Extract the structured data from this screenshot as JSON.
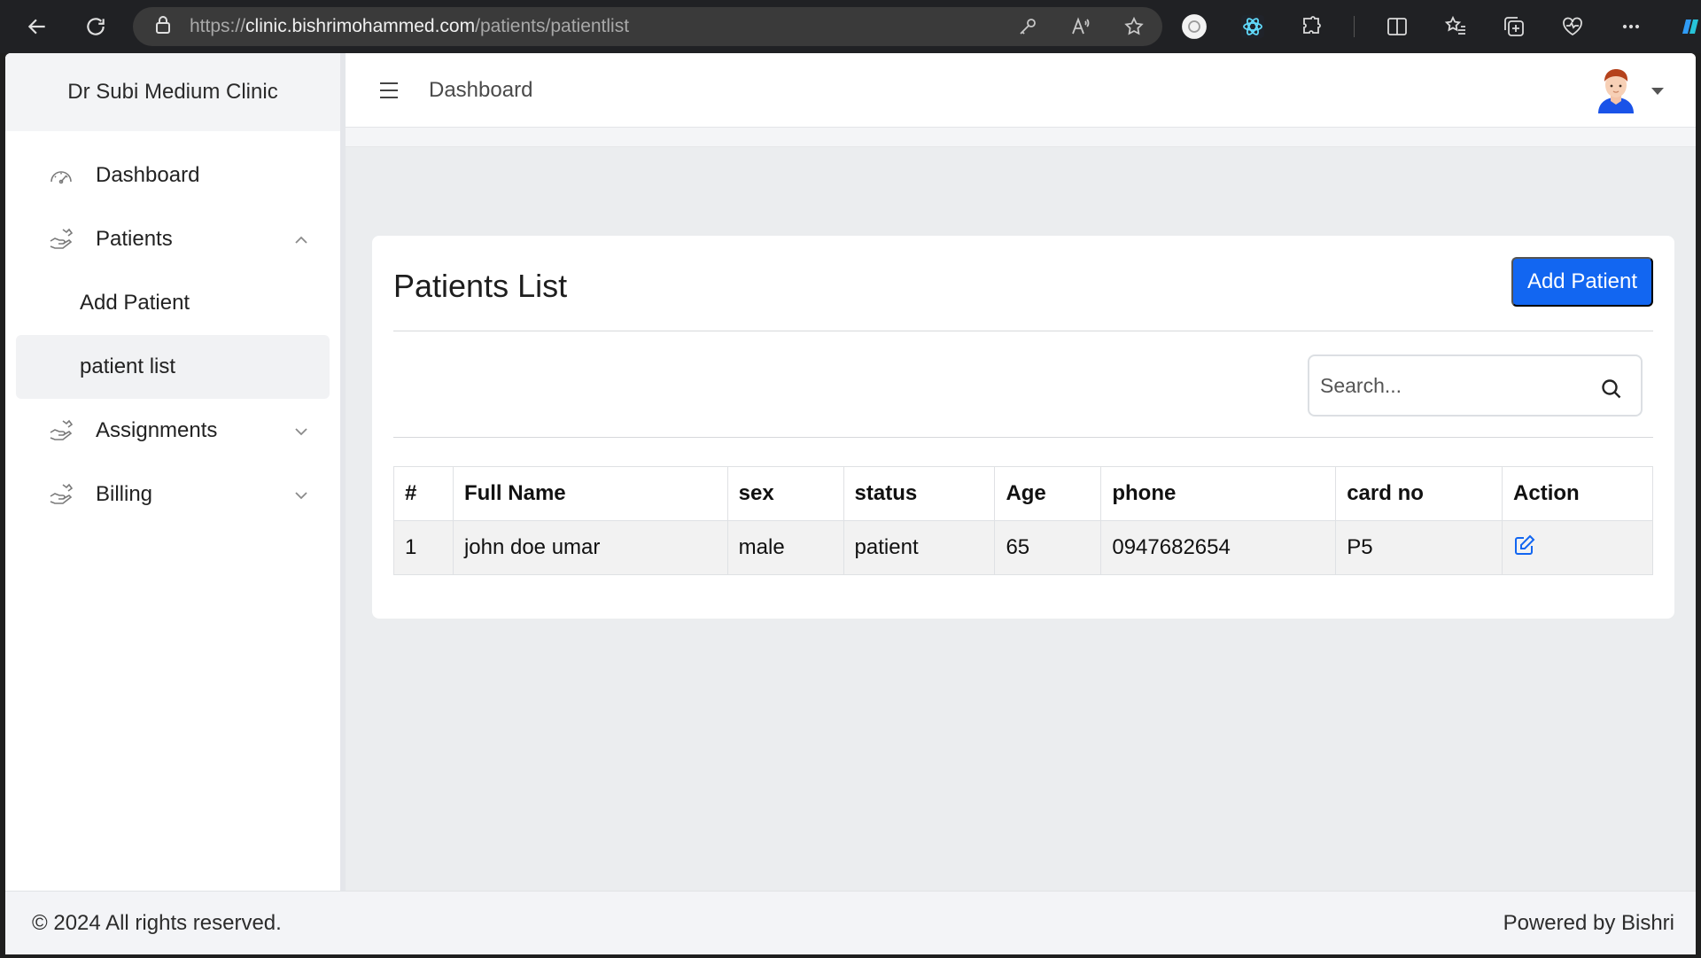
{
  "browser": {
    "url_scheme": "https://",
    "url_host": "clinic.bishrimohammed.com",
    "url_path": "/patients/patientlist"
  },
  "sidebar": {
    "brand": "Dr Subi Medium Clinic",
    "items": [
      {
        "label": "Dashboard",
        "icon": "dashboard-gauge-icon"
      },
      {
        "label": "Patients",
        "icon": "patients-hand-icon",
        "expanded": true
      },
      {
        "label": "Add Patient"
      },
      {
        "label": "patient list",
        "active": true
      },
      {
        "label": "Assignments",
        "icon": "assignments-hand-icon",
        "expanded": false
      },
      {
        "label": "Billing",
        "icon": "billing-hand-icon",
        "expanded": false
      }
    ]
  },
  "topbar": {
    "title": "Dashboard"
  },
  "card": {
    "title": "Patients List",
    "add_button": "Add Patient"
  },
  "search": {
    "placeholder": "Search..."
  },
  "table": {
    "headers": [
      "#",
      "Full Name",
      "sex",
      "status",
      "Age",
      "phone",
      "card no",
      "Action"
    ],
    "rows": [
      {
        "num": "1",
        "full_name": "john doe umar",
        "sex": "male",
        "status": "patient",
        "age": "65",
        "phone": "0947682654",
        "card_no": "P5",
        "action": "edit-icon"
      }
    ]
  },
  "footer": {
    "copyright": "© 2024 All rights reserved.",
    "powered_by": "Powered by Bishri"
  },
  "colors": {
    "primary": "#1266f1",
    "browser_chrome": "#202124",
    "content_bg": "#ebedef"
  }
}
